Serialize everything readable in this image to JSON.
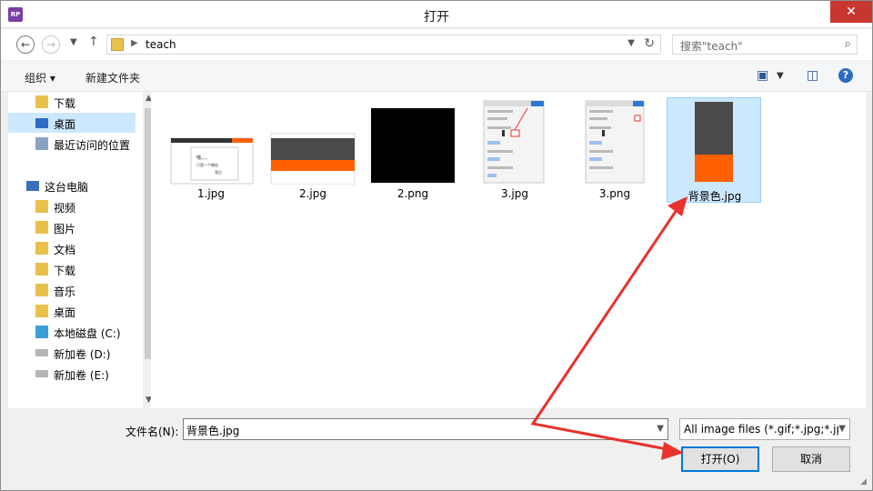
{
  "window": {
    "title": "打开",
    "app_icon_text": "RP",
    "close_glyph": "✕"
  },
  "address": {
    "crumb": "teach",
    "search_placeholder": "搜索\"teach\""
  },
  "toolbar": {
    "organize": "组织 ▾",
    "new_folder": "新建文件夹"
  },
  "nav": {
    "items": [
      {
        "label": "下载",
        "icon": "download-folder-icon"
      },
      {
        "label": "桌面",
        "icon": "desktop-icon",
        "selected": true
      },
      {
        "label": "最近访问的位置",
        "icon": "recent-places-icon"
      },
      {
        "label": "这台电脑",
        "icon": "computer-icon"
      },
      {
        "label": "视频",
        "icon": "videos-folder-icon"
      },
      {
        "label": "图片",
        "icon": "pictures-folder-icon"
      },
      {
        "label": "文档",
        "icon": "documents-folder-icon"
      },
      {
        "label": "下载",
        "icon": "download-folder-icon"
      },
      {
        "label": "音乐",
        "icon": "music-folder-icon"
      },
      {
        "label": "桌面",
        "icon": "desktop-folder-icon"
      },
      {
        "label": "本地磁盘 (C:)",
        "icon": "local-disk-icon"
      },
      {
        "label": "新加卷 (D:)",
        "icon": "drive-icon"
      },
      {
        "label": "新加卷 (E:)",
        "icon": "drive-icon"
      }
    ]
  },
  "files": [
    {
      "name": "1.jpg"
    },
    {
      "name": "2.jpg"
    },
    {
      "name": "2.png"
    },
    {
      "name": "3.jpg"
    },
    {
      "name": "3.png"
    },
    {
      "name": "背景色.jpg",
      "selected": true
    }
  ],
  "thumb_text": {
    "line1": "喵。。。",
    "line2": "只是一个做馅",
    "line3": "背后"
  },
  "bottom": {
    "filename_label": "文件名(N):",
    "filename_value": "背景色.jpg",
    "filter_value": "All image files (*.gif;*.jpg;*.jp",
    "open_label": "打开(O)",
    "cancel_label": "取消"
  },
  "colors": {
    "accent": "#0078d7",
    "selection": "#cce8ff",
    "arrow": "#e8322d",
    "orange": "#ff6100",
    "dark_gray": "#444444"
  }
}
